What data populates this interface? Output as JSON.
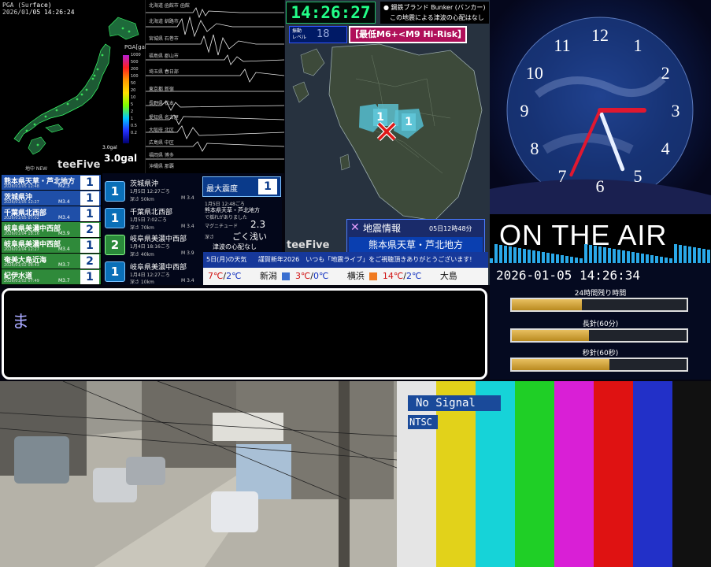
{
  "pga": {
    "title": "PGA (Surface)",
    "timestamp": "2026/01/05 14:26:24",
    "scale_label": "PGA[gal]",
    "scale_ticks": [
      "1000",
      "500",
      "200",
      "100",
      "50",
      "20",
      "10",
      "5",
      "2",
      "1",
      "0.5",
      "0.2",
      "0.1"
    ],
    "max_small": "3.0gal",
    "max_value": "3.0gal",
    "brand": "teeFive",
    "mini_label": "地中 NEW"
  },
  "waveform": {
    "stations": [
      "北海道 函館市 函館",
      "北海道 釧路市",
      "宮城県 石巻市",
      "福島県 郡山市",
      "埼玉県 春日部",
      "東京都 新宿",
      "長野県 松本",
      "愛知県 名古屋",
      "大阪府 北区",
      "広島県 中区",
      "福岡県 博多",
      "沖縄県 那覇"
    ],
    "brand": "teeFive"
  },
  "eq_list": [
    {
      "name": "熊本県天草・芦北地方",
      "date": "2026/01/05 12:48",
      "mag": "M2.3",
      "shindo": "1",
      "color": "#1f4fa8"
    },
    {
      "name": "茨城県沖",
      "date": "2026/01/05 12:27",
      "mag": "M3.4",
      "shindo": "1",
      "color": "#1f4fa8"
    },
    {
      "name": "千葉県北西部",
      "date": "2026/01/05 07:02",
      "mag": "M3.4",
      "shindo": "1",
      "color": "#1f4fa8"
    },
    {
      "name": "岐阜県美濃中西部",
      "date": "2026/01/04 18:16",
      "mag": "M3.9",
      "shindo": "2",
      "color": "#2f8a3a"
    },
    {
      "name": "岐阜県美濃中西部",
      "date": "2026/01/04 12:27",
      "mag": "M3.4",
      "shindo": "1",
      "color": "#2f8a3a"
    },
    {
      "name": "奄美大島近海",
      "date": "2026/01/02 08:43",
      "mag": "M3.7",
      "shindo": "2",
      "color": "#2f8a3a"
    },
    {
      "name": "紀伊水道",
      "date": "2026/01/02 07:49",
      "mag": "M3.7",
      "shindo": "1",
      "color": "#2f8a3a"
    }
  ],
  "eq_detail": {
    "items": [
      {
        "shindo": "1",
        "name": "茨城県沖",
        "date": "1月5日 12:27ごろ",
        "depth": "深さ 50km",
        "mag": "M 3.4"
      },
      {
        "shindo": "1",
        "name": "千葉県北西部",
        "date": "1月5日 7:02ごろ",
        "depth": "深さ 70km",
        "mag": "M 3.4"
      },
      {
        "shindo": "2",
        "name": "岐阜県美濃中西部",
        "date": "1月4日 18:16ごろ",
        "depth": "深さ 40km",
        "mag": "M 3.9"
      },
      {
        "shindo": "1",
        "name": "岐阜県美濃中西部",
        "date": "1月4日 12:27ごろ",
        "depth": "深さ 10km",
        "mag": "M 3.4"
      }
    ],
    "max_label": "最大震度",
    "max_value": "1",
    "latest_date": "1月5日 12:48ごろ",
    "latest_name": "熊本県天草・芦北地方",
    "latest_note": "で揺れがありました",
    "magnitude_label": "マグニチュード",
    "magnitude_value": "2.3",
    "depth_label": "深さ",
    "depth_value": "ごく浅い",
    "tsunami": "津波の心配なし",
    "brand": "teeFive"
  },
  "center": {
    "clock": "14:26:27",
    "bunker_line1": "● 鋼鉄ブランド Bunker (バンカー)",
    "bunker_line2": "この地震による津波の心配はなし",
    "level_label": "振動\nレベル",
    "level_value": "18",
    "risk": "【最低M6+<M9 Hi-Risk】",
    "shindo_marks": [
      "1",
      "1"
    ],
    "eqinfo_title": "地震情報",
    "eqinfo_time": "05日12時48分",
    "eqinfo_place": "熊本県天草・芦北地方",
    "brand": "teeFive"
  },
  "weather": {
    "ticker_day": "5日(月)の天気",
    "ticker_msg": "謹賀新年2026　いつも「地震ライブ」をご視聴頂きありがとうございます!",
    "temps": [
      {
        "city": "",
        "hi": "7℃",
        "lo": "2℃"
      },
      {
        "city": "新潟",
        "hi": "3℃",
        "lo": "0℃"
      },
      {
        "city": "横浜",
        "hi": "14℃",
        "lo": "2℃"
      },
      {
        "city": "大島",
        "hi": "",
        "lo": ""
      }
    ]
  },
  "space_clock": {
    "numerals": [
      "12",
      "1",
      "2",
      "3",
      "4",
      "5",
      "6",
      "7",
      "8",
      "9",
      "10",
      "11"
    ],
    "hour_deg": 90,
    "minute_deg": 159,
    "second_deg": 204
  },
  "onair": {
    "title": "ON THE AIR",
    "datetime": "2026-01-05 14:26:34",
    "bars": [
      {
        "label": "24時間残り時間",
        "fraction": 0.4
      },
      {
        "label": "長針(60分)",
        "fraction": 0.44
      },
      {
        "label": "秒針(60秒)",
        "fraction": 0.56
      }
    ]
  },
  "message": {
    "text": "ま"
  },
  "test_signal": {
    "no_signal": "No Signal",
    "standard": "NTSC",
    "colors": [
      "#e5e5e5",
      "#e2d21a",
      "#16d3d8",
      "#1fcf26",
      "#d91fd6",
      "#df1212",
      "#2230c8",
      "#111111"
    ]
  }
}
